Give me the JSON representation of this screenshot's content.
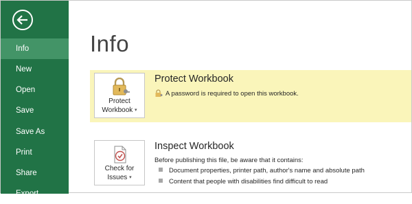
{
  "sidebar": {
    "back_icon": "back-arrow-icon",
    "items": [
      {
        "label": "Info",
        "active": true
      },
      {
        "label": "New"
      },
      {
        "label": "Open"
      },
      {
        "label": "Save"
      },
      {
        "label": "Save As"
      },
      {
        "label": "Print"
      },
      {
        "label": "Share"
      },
      {
        "label": "Export"
      }
    ]
  },
  "main": {
    "title": "Info",
    "protect": {
      "button_line1": "Protect",
      "button_line2": "Workbook",
      "title": "Protect Workbook",
      "status": "A password is required to open this workbook.",
      "icon": "lock-key-icon"
    },
    "inspect": {
      "button_line1": "Check for",
      "button_line2": "Issues",
      "title": "Inspect Workbook",
      "description": "Before publishing this file, be aware that it contains:",
      "bullets": [
        "Document properties, printer path, author's name and absolute path",
        "Content that people with disabilities find difficult to read"
      ],
      "icon": "document-check-icon"
    }
  },
  "colors": {
    "sidebar_bg": "#217346",
    "sidebar_active": "#439467",
    "highlight": "#faf5ba"
  }
}
